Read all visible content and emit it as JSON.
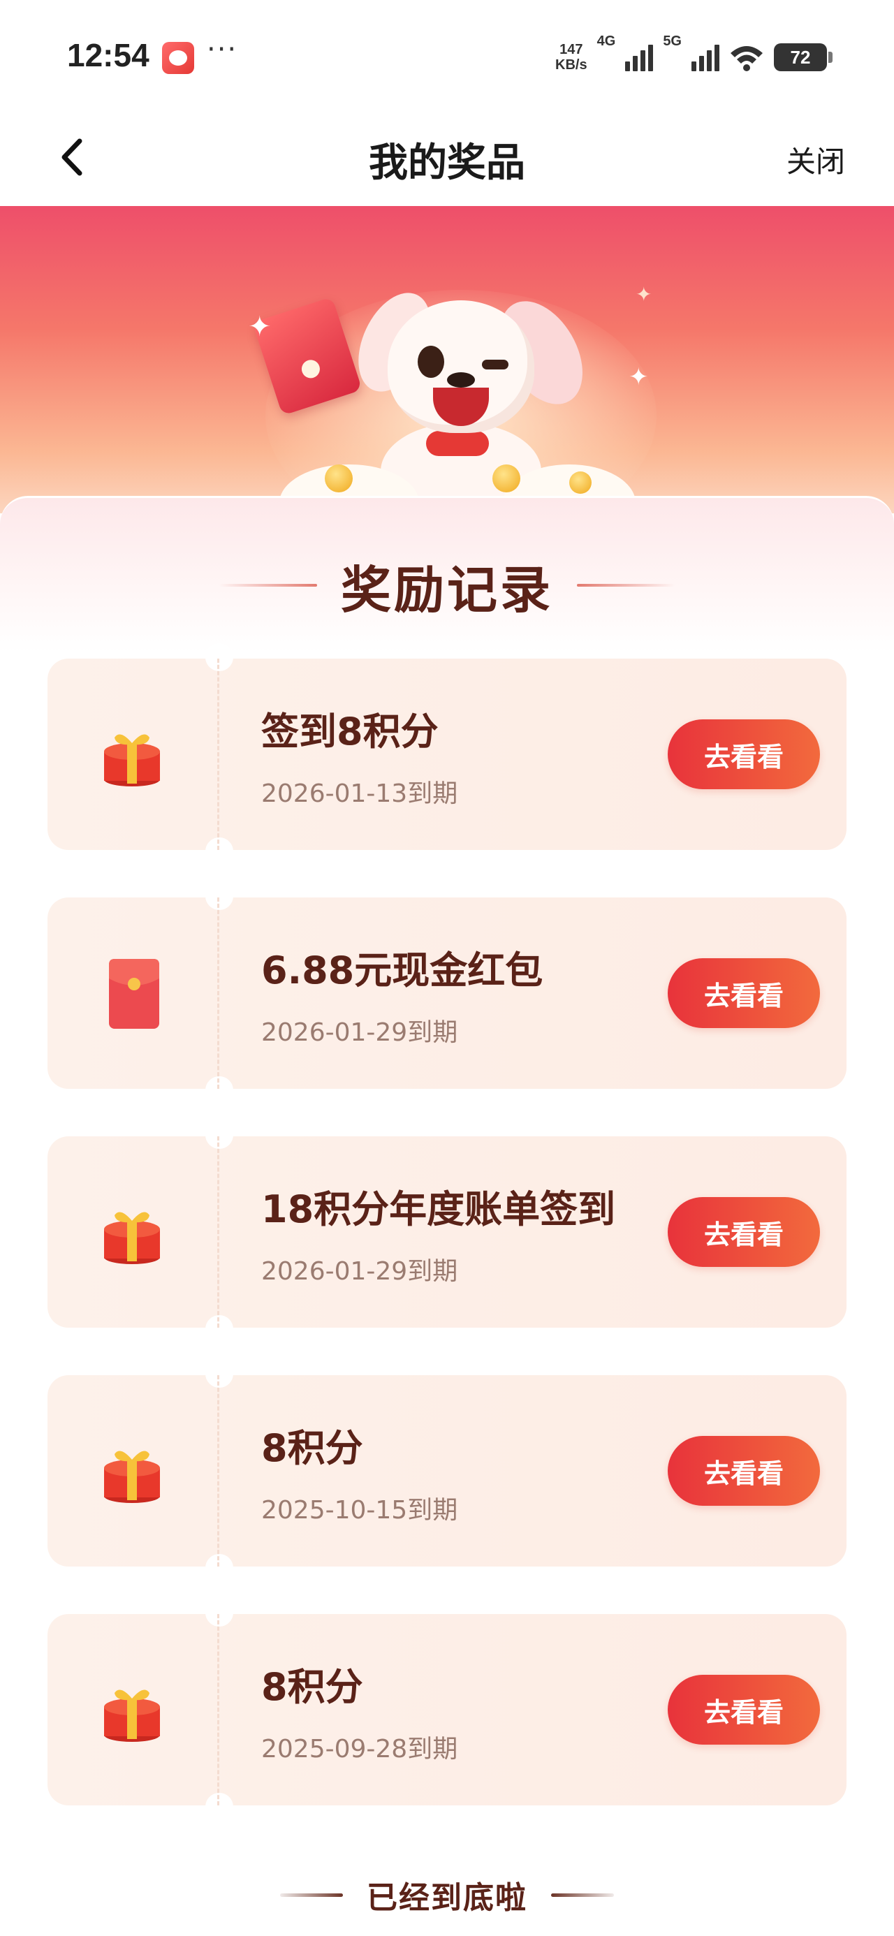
{
  "status_bar": {
    "time": "12:54",
    "more": "···",
    "speed_value": "147",
    "speed_unit": "KB/s",
    "net_4g": "4G",
    "net_5g": "5G",
    "battery": "72"
  },
  "nav": {
    "title": "我的奖品",
    "close_label": "关闭"
  },
  "section": {
    "title": "奖励记录"
  },
  "rewards": [
    {
      "name": "签到8积分",
      "expire": "2026-01-13到期",
      "button": "去看看",
      "icon": "gift-box-icon"
    },
    {
      "name": "6.88元现金红包",
      "expire": "2026-01-29到期",
      "button": "去看看",
      "icon": "red-envelope-icon"
    },
    {
      "name": "18积分年度账单签到",
      "expire": "2026-01-29到期",
      "button": "去看看",
      "icon": "gift-box-icon"
    },
    {
      "name": "8积分",
      "expire": "2025-10-15到期",
      "button": "去看看",
      "icon": "gift-box-icon"
    },
    {
      "name": "8积分",
      "expire": "2025-09-28到期",
      "button": "去看看",
      "icon": "gift-box-icon"
    }
  ],
  "footer": {
    "end_text": "已经到底啦"
  },
  "colors": {
    "accent_start": "#e8333b",
    "accent_end": "#f26a3d",
    "title_brown": "#5a2218",
    "card_bg": "#fdefe7"
  }
}
